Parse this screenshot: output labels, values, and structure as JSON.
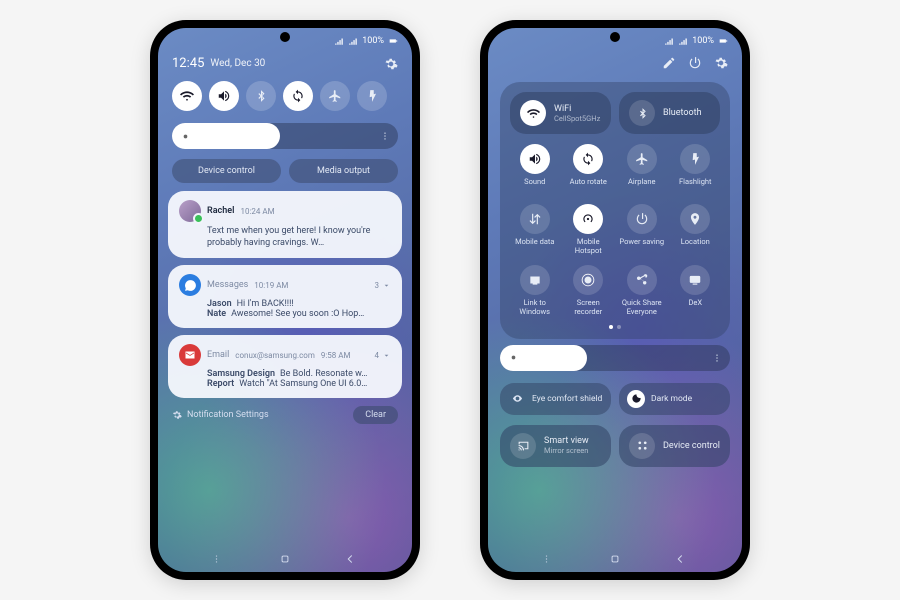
{
  "status": {
    "battery": "100%"
  },
  "left": {
    "time": "12:45",
    "date": "Wed, Dec 30",
    "brightness_percent": 48,
    "device_control": "Device control",
    "media_output": "Media output",
    "notif_settings": "Notification Settings",
    "clear": "Clear",
    "notifications": [
      {
        "app": "",
        "sender": "Rachel",
        "timestamp": "10:24 AM",
        "body": "Text me when you get here! I know you're probably having cravings. W…"
      },
      {
        "app": "Messages",
        "timestamp": "10:19 AM",
        "count": "3",
        "lines": [
          {
            "name": "Jason",
            "text": "Hi I'm BACK!!!!"
          },
          {
            "name": "Nate",
            "text": "Awesome! See you soon :O Hop…"
          }
        ]
      },
      {
        "app": "Email",
        "from": "conux@samsung.com",
        "timestamp": "9:58 AM",
        "count": "4",
        "lines": [
          {
            "name": "Samsung Design",
            "text": "Be Bold. Resonate w…"
          },
          {
            "name": "Report",
            "text": "Watch \"At Samsung One UI 6.0…"
          }
        ]
      }
    ]
  },
  "right": {
    "brightness_percent": 38,
    "wifi": {
      "label": "WiFi",
      "sub": "CellSpot5GHz"
    },
    "bluetooth": {
      "label": "Bluetooth"
    },
    "tiles": [
      {
        "label": "Sound",
        "on": true,
        "icon": "volume"
      },
      {
        "label": "Auto rotate",
        "on": true,
        "icon": "rotate"
      },
      {
        "label": "Airplane",
        "on": false,
        "icon": "airplane"
      },
      {
        "label": "Flashlight",
        "on": false,
        "icon": "flashlight"
      },
      {
        "label": "Mobile data",
        "on": false,
        "icon": "data"
      },
      {
        "label": "Mobile Hotspot",
        "on": true,
        "icon": "hotspot"
      },
      {
        "label": "Power saving",
        "on": false,
        "icon": "power"
      },
      {
        "label": "Location",
        "on": false,
        "icon": "location"
      },
      {
        "label": "Link to Windows",
        "on": false,
        "icon": "link"
      },
      {
        "label": "Screen recorder",
        "on": false,
        "icon": "record"
      },
      {
        "label": "Quick Share Everyone",
        "on": false,
        "icon": "share"
      },
      {
        "label": "DeX",
        "on": false,
        "icon": "dex"
      }
    ],
    "eye_comfort": "Eye comfort shield",
    "dark_mode": "Dark mode",
    "smart_view": {
      "label": "Smart view",
      "sub": "Mirror screen"
    },
    "device_control": "Device control"
  }
}
